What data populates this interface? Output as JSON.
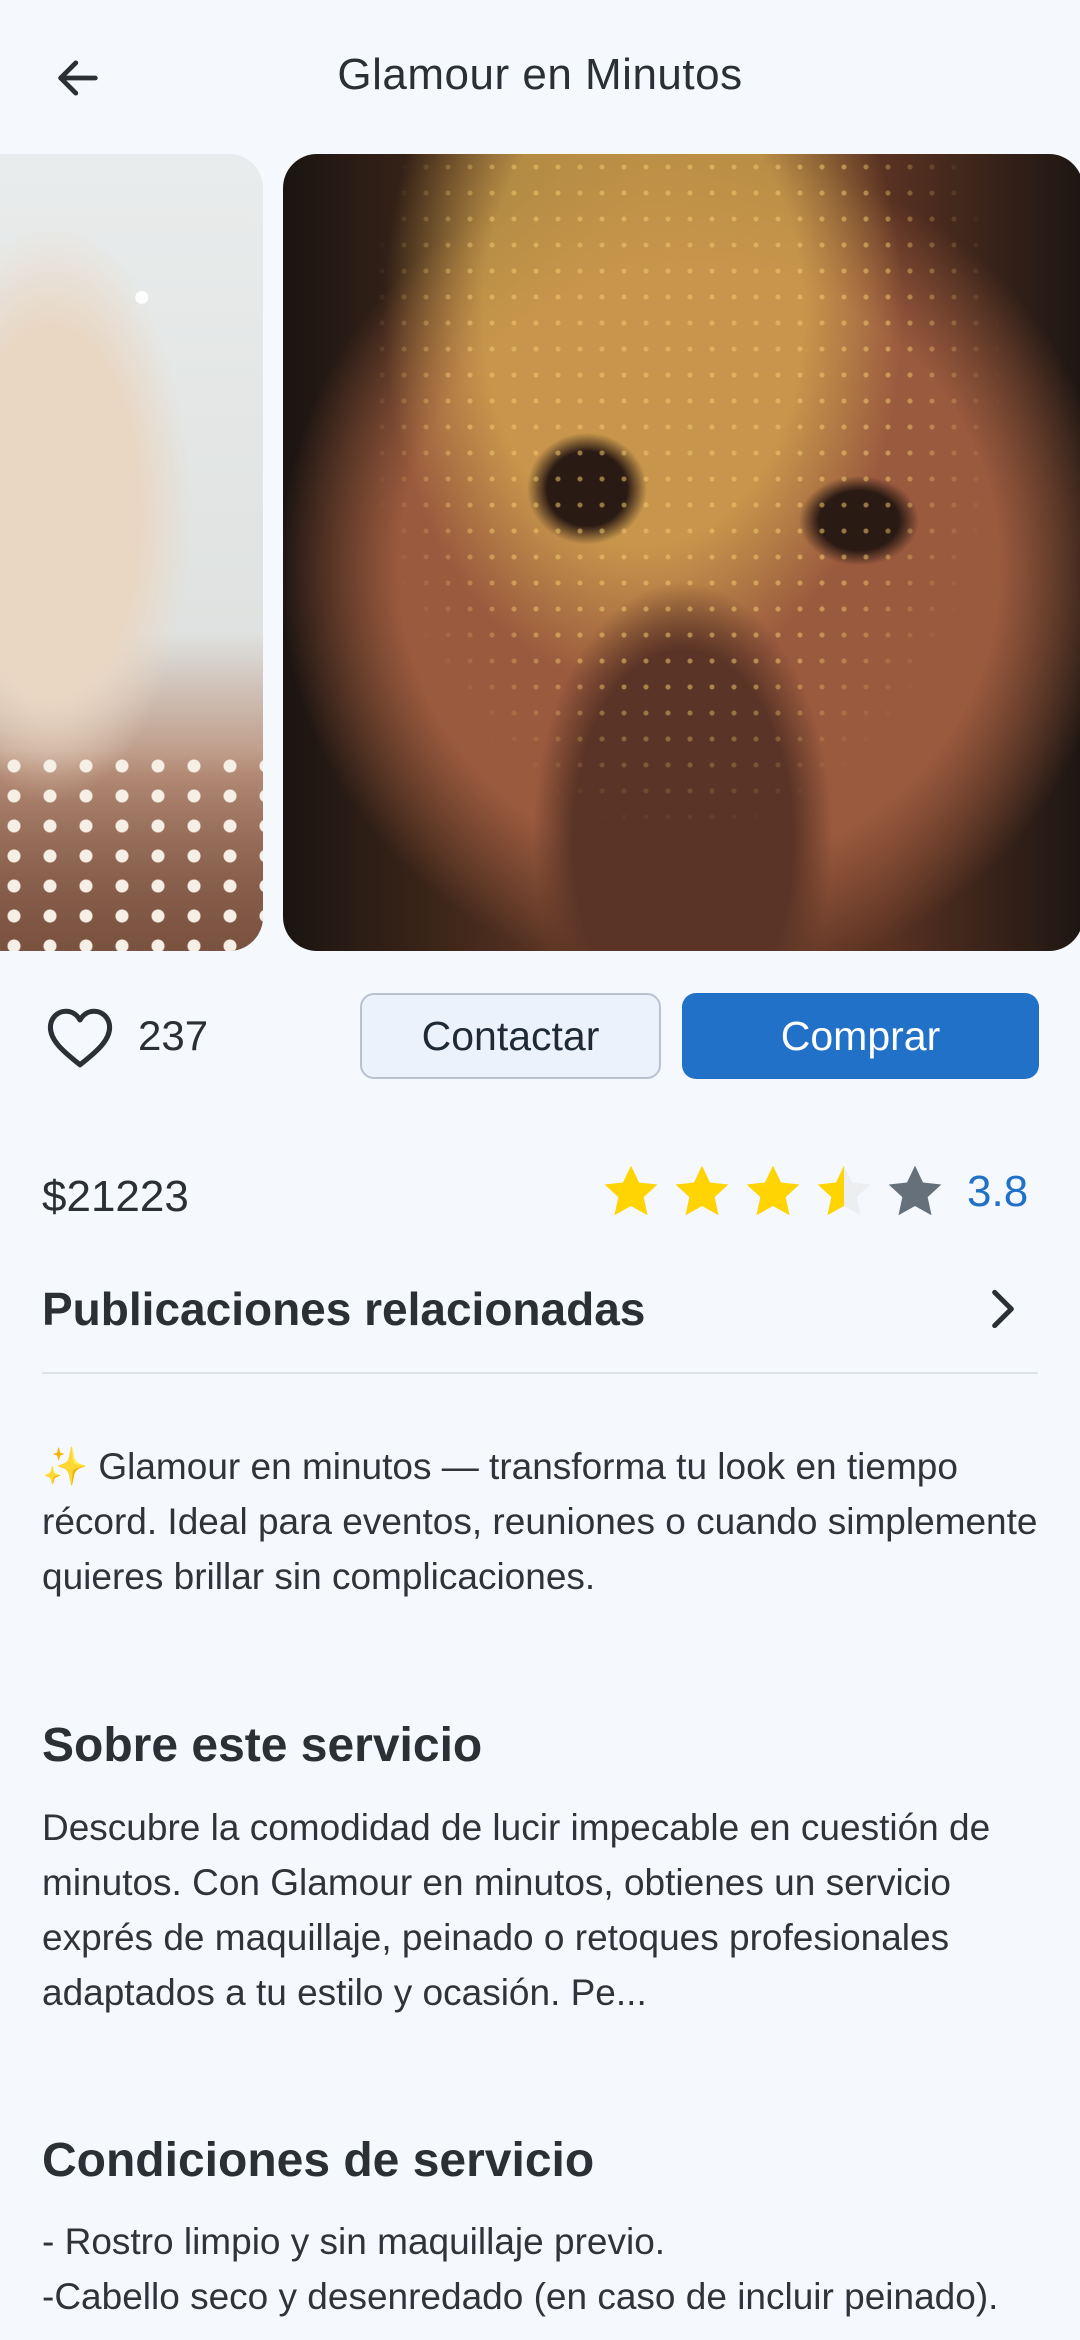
{
  "header": {
    "title": "Glamour en Minutos",
    "back_icon": "arrow-left-icon"
  },
  "gallery": {
    "images": [
      "makeup-photo-left",
      "makeup-photo-gold-glitter"
    ]
  },
  "actions": {
    "like_icon": "heart-outline-icon",
    "like_count": "237",
    "contact_label": "Contactar",
    "buy_label": "Comprar"
  },
  "product": {
    "price": "$21223",
    "rating": 3.8,
    "rating_text": "3.8",
    "stars": [
      "full",
      "full",
      "full",
      "half",
      "empty"
    ],
    "star_color": "#FFD400",
    "empty_star_color": "#66707A"
  },
  "related": {
    "label": "Publicaciones relacionadas",
    "chevron_icon": "chevron-right-icon"
  },
  "description": {
    "intro": "✨ Glamour en minutos — transforma tu look en tiempo récord. Ideal para eventos, reuniones o cuando simplemente quieres brillar sin complicaciones."
  },
  "about": {
    "title": "Sobre este servicio",
    "text": "Descubre la comodidad de lucir impecable en cuestión de minutos. Con Glamour en minutos, obtienes un servicio exprés de maquillaje, peinado o retoques profesionales adaptados a tu estilo y ocasión. Pe..."
  },
  "conditions": {
    "title": "Condiciones de servicio",
    "text": "- Rostro limpio y sin maquillaje previo.\n -Cabello seco y desenredado (en caso de incluir peinado)."
  },
  "colors": {
    "accent": "#2271C8",
    "background": "#F5F8FD",
    "contact_bg": "#ECF2FB"
  }
}
